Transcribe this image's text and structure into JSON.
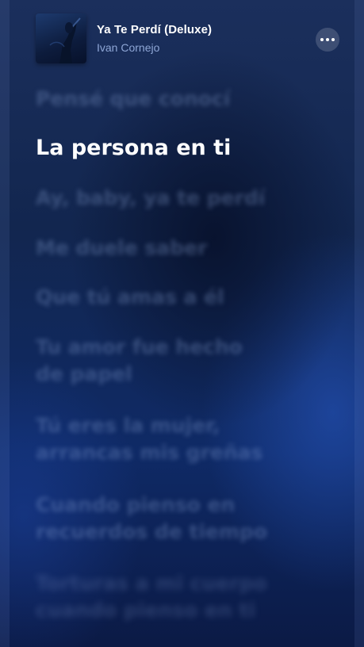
{
  "now_playing": {
    "title": "Ya Te Perdí (Deluxe)",
    "artist": "Ivan Cornejo",
    "art_icon": "album-art",
    "more_icon": "more-horizontal-icon"
  },
  "lyrics": {
    "lines": [
      {
        "text": [
          "Pensé que conocí"
        ],
        "state": "past"
      },
      {
        "text": [
          "La persona en ti"
        ],
        "state": "current"
      },
      {
        "text": [
          "Ay, baby, ya te perdí"
        ],
        "state": "upcoming"
      },
      {
        "text": [
          "Me duele saber"
        ],
        "state": "upcoming"
      },
      {
        "text": [
          "Que tú amas a él"
        ],
        "state": "upcoming"
      },
      {
        "text": [
          "Tu amor fue hecho",
          "de papel"
        ],
        "state": "upcoming"
      },
      {
        "text": [
          "Tú eres la mujer,",
          "arrancas mis greñas"
        ],
        "state": "upcoming"
      },
      {
        "text": [
          "Cuando pienso en",
          "recuerdos de tiempo"
        ],
        "state": "upcoming"
      },
      {
        "text": [
          "Torturas a mi cuerpo",
          "cuando pienso en ti"
        ],
        "state": "upcoming"
      }
    ]
  },
  "colors": {
    "current_line": "#ffffff",
    "artist_text": "#8ea6d6",
    "background": "#12264f"
  }
}
